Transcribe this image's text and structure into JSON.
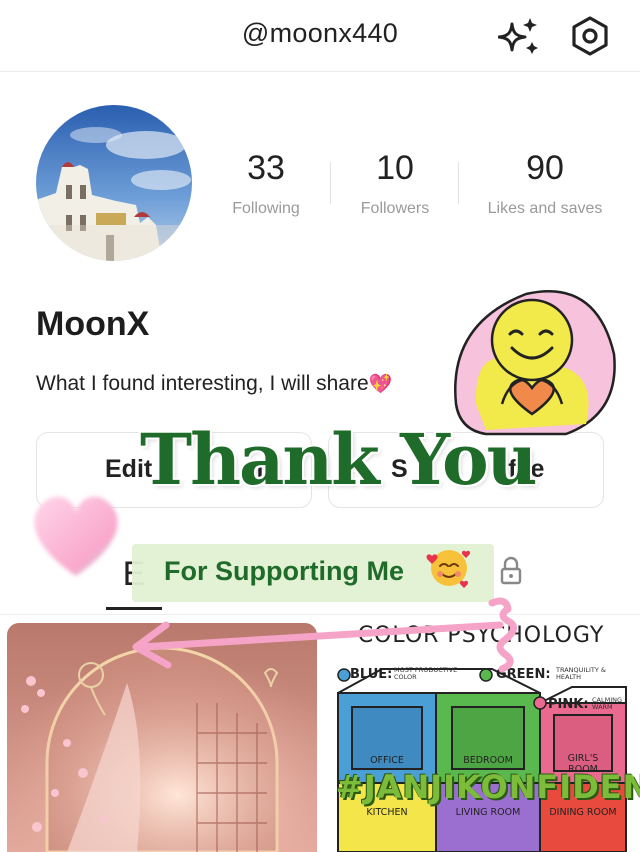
{
  "header": {
    "handle": "@moonx440"
  },
  "stats": [
    {
      "value": "33",
      "label": "Following"
    },
    {
      "value": "10",
      "label": "Followers"
    },
    {
      "value": "90",
      "label": "Likes and saves"
    }
  ],
  "profile": {
    "name": "MoonX",
    "bio": "What I found interesting, I will share",
    "bio_emoji": "💖"
  },
  "buttons": {
    "edit": "Edit",
    "edit_tail": "m",
    "share_mid": "S",
    "share_tail": "a",
    "share_end": "ofile"
  },
  "tabs": {
    "active_label": "E"
  },
  "overlay": {
    "thank_you": "Thank You",
    "supporting": "For Supporting Me",
    "hashtag": "#JANJIKONFIDEN"
  },
  "posts": {
    "color_psychology": {
      "title": "COLOR PSYCHOLOGY",
      "blue": "BLUE:",
      "blue_note": "MOST PRODUCTIVE COLOR",
      "green": "GREEN:",
      "green_note": "TRANQUILITY & HEALTH",
      "pink": "PINK:",
      "pink_note": "CALMING WARM",
      "rooms": {
        "office": "OFFICE",
        "bedroom": "BEDROOM",
        "girls_room": "GIRL'S ROOM",
        "kitchen": "KITCHEN",
        "living_room": "LIVING ROOM",
        "dining_room": "DINING ROOM"
      }
    }
  },
  "colors": {
    "accent_green": "#1f6b2a",
    "pink": "#f7a6c8",
    "stat_label": "#9a9a9a"
  }
}
